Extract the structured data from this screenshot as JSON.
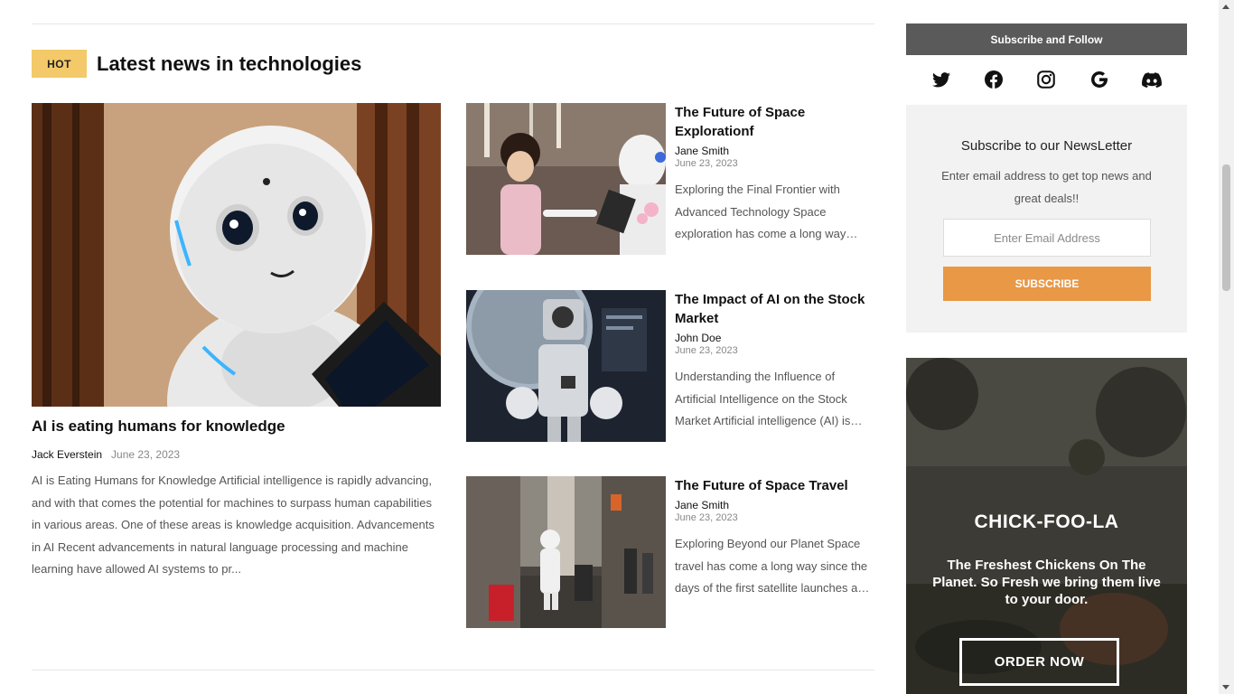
{
  "section": {
    "badge": "HOT",
    "title": "Latest news in technologies"
  },
  "featured": {
    "image_desc": "white humanoid robot holding tablet",
    "title": "AI is eating humans for knowledge",
    "author": "Jack Everstein",
    "date": "June 23, 2023",
    "excerpt": "AI is Eating Humans for Knowledge Artificial intelligence is rapidly advancing, and with that comes the potential for machines to surpass human capabilities in various areas. One of these areas is knowledge acquisition. Advancements in AI Recent advancements in natural language processing and machine learning have allowed AI systems to pr..."
  },
  "articles": [
    {
      "title": "The Future of Space Explorationf",
      "author": "Jane Smith",
      "date": "June 23, 2023",
      "excerpt": "Exploring the Final Frontier with Advanced Technology Space exploration has come a long way since the first satellite launches and ..."
    },
    {
      "title": "The Impact of AI on the Stock Market",
      "author": "John Doe",
      "date": "June 23, 2023",
      "excerpt": "Understanding the Influence of Artificial Intelligence on the Stock Market Artificial intelligence (AI) is transforming the stock market..."
    },
    {
      "title": "The Future of Space Travel",
      "author": "Jane Smith",
      "date": "June 23, 2023",
      "excerpt": "Exploring Beyond our Planet Space travel has come a long way since the days of the first satellite launches and continues..."
    }
  ],
  "sidebar": {
    "follow_title": "Subscribe and Follow",
    "social": [
      "twitter-icon",
      "facebook-icon",
      "instagram-icon",
      "google-icon",
      "discord-icon"
    ],
    "newsletter": {
      "title": "Subscribe to our NewsLetter",
      "description": "Enter email address to get top news and great deals!!",
      "placeholder": "Enter Email Address",
      "button": "SUBSCRIBE"
    },
    "ad": {
      "brand": "CHICK-FOO-LA",
      "tagline": "The Freshest Chickens On The Planet. So Fresh we bring them live to your door.",
      "button": "ORDER NOW"
    }
  },
  "colors": {
    "badge": "#f3c969",
    "follow_bar": "#5a5a5a",
    "subscribe_button": "#e99846",
    "newsletter_bg": "#f2f2f2"
  }
}
